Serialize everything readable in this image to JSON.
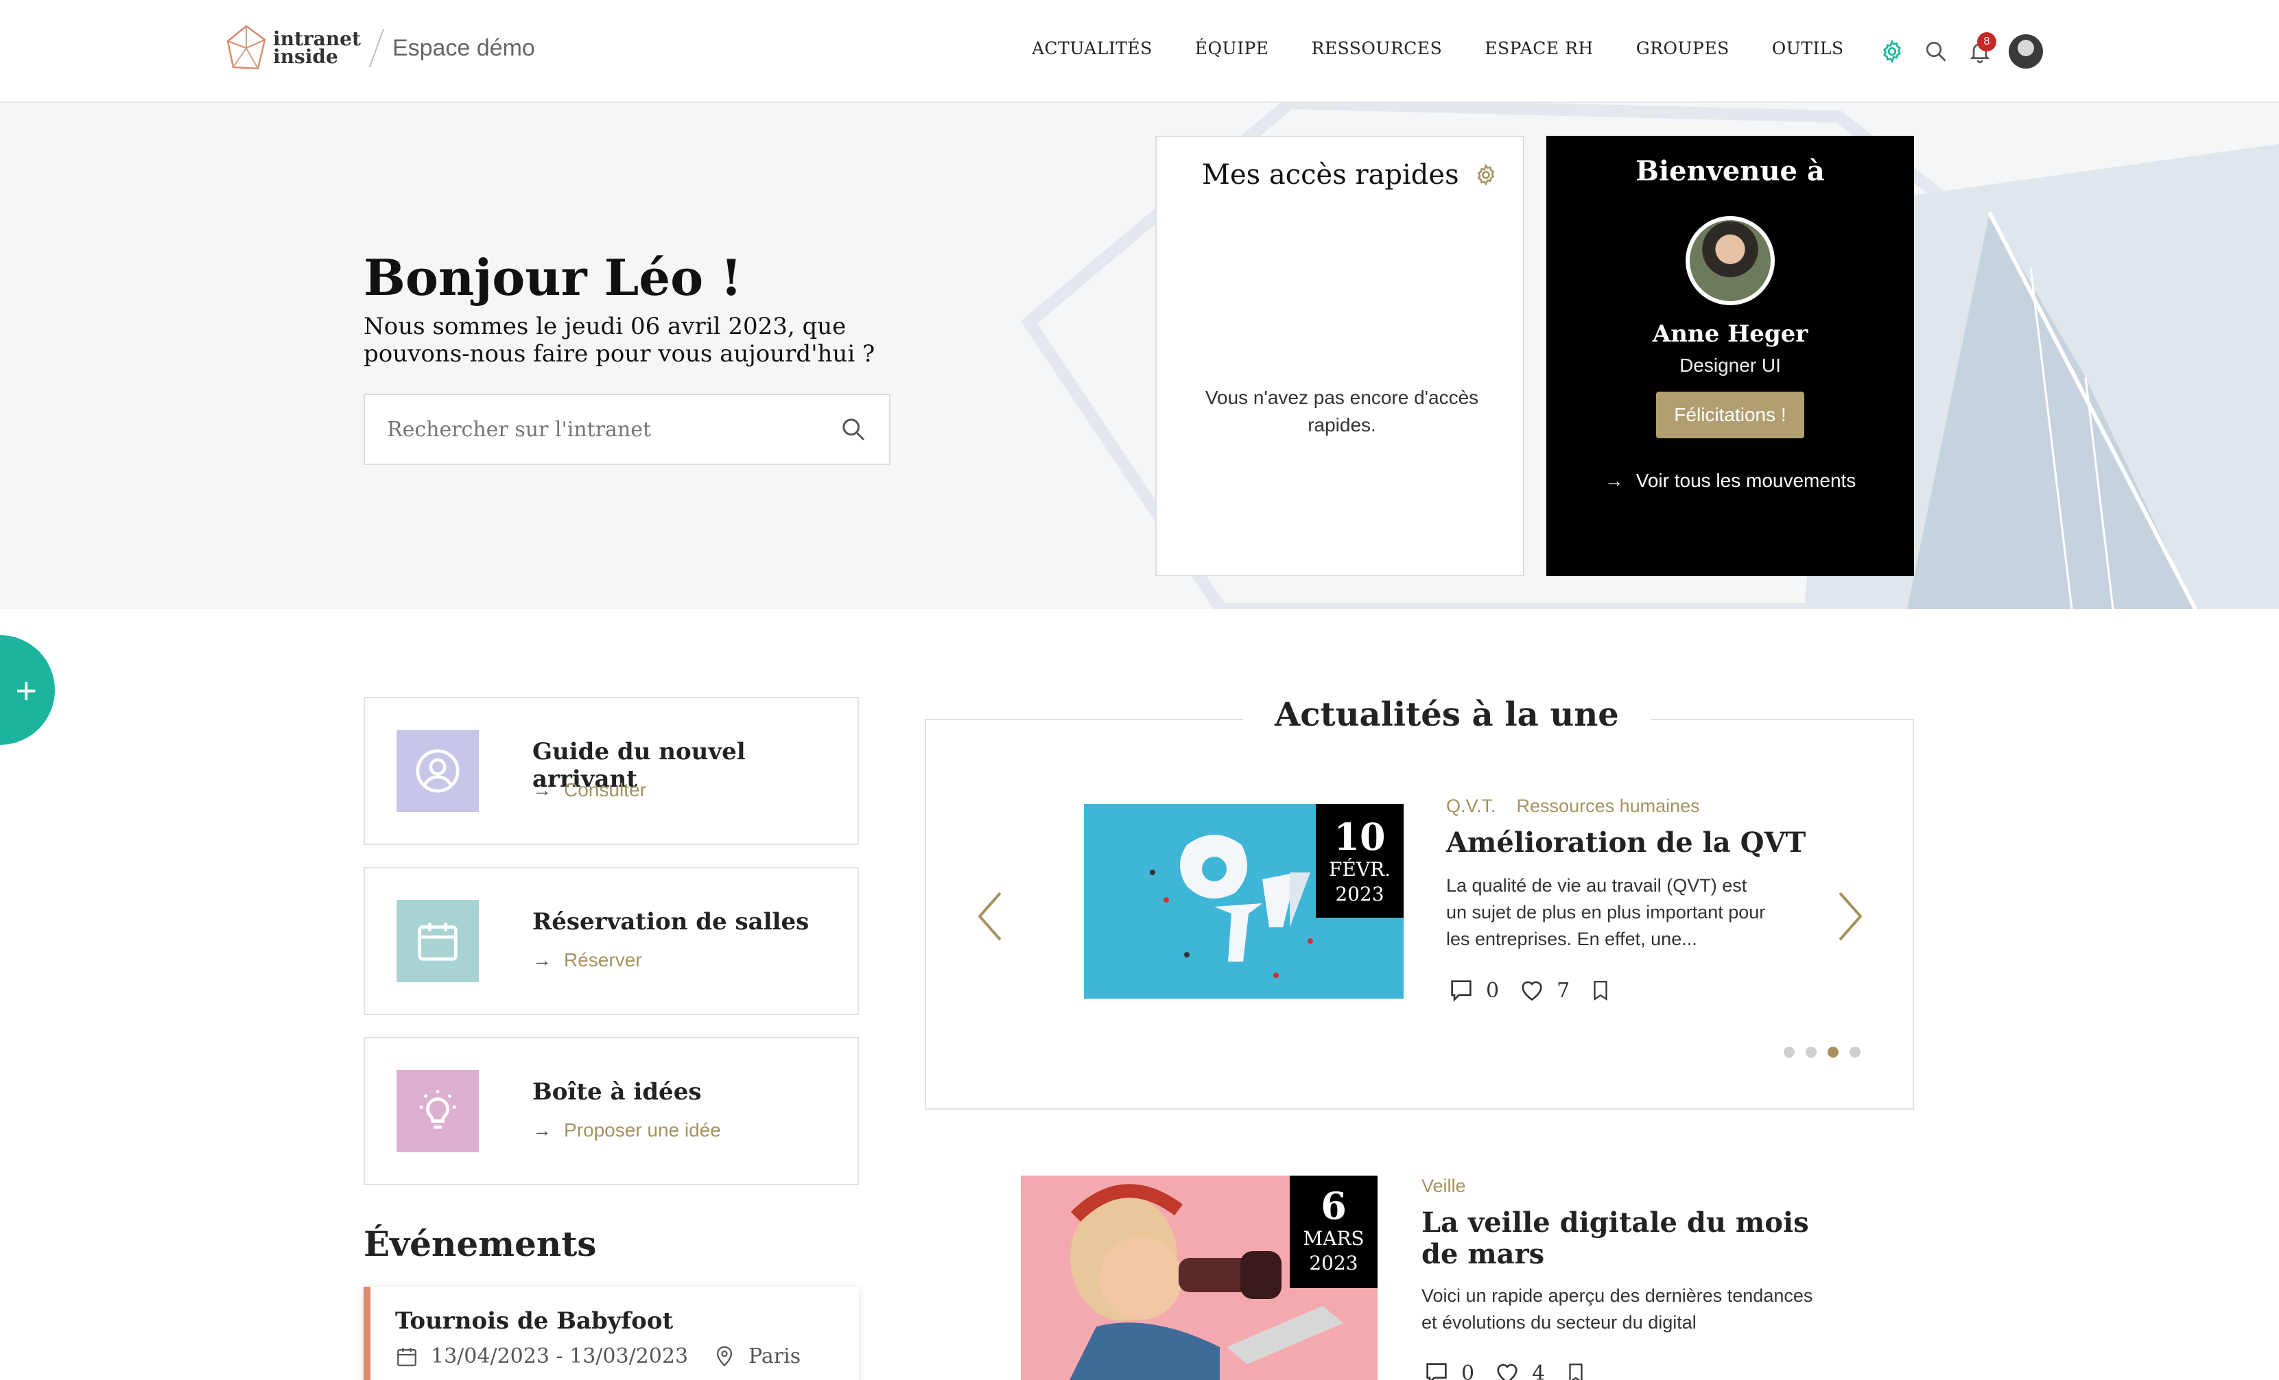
{
  "header": {
    "logo_line1": "intranet",
    "logo_line2": "inside",
    "space_name": "Espace démo",
    "nav": [
      "ACTUALITÉS",
      "ÉQUIPE",
      "RESSOURCES",
      "ESPACE RH",
      "GROUPES",
      "OUTILS"
    ],
    "notifications_count": "8",
    "accent_color": "#1cb49c"
  },
  "hero": {
    "greeting": "Bonjour Léo !",
    "subtitle": "Nous sommes le jeudi 06 avril 2023, que pouvons-nous faire pour vous aujourd'hui ?",
    "search_placeholder": "Rechercher sur l'intranet"
  },
  "quick_access": {
    "title": "Mes accès rapides",
    "empty_text": "Vous n'avez pas encore d'accès rapides."
  },
  "welcome": {
    "title": "Bienvenue à",
    "name": "Anne Heger",
    "role": "Designer UI",
    "button": "Félicitations !",
    "link": "Voir tous les mouvements"
  },
  "fab_label": "+",
  "cards": [
    {
      "title": "Guide du nouvel arrivant",
      "link": "Consulter",
      "icon": "user-circle-icon",
      "color": "#c8c6e8"
    },
    {
      "title": "Réservation de salles",
      "link": "Réserver",
      "icon": "calendar-icon",
      "color": "#a9d3d3"
    },
    {
      "title": "Boîte à idées",
      "link": "Proposer une idée",
      "icon": "lightbulb-icon",
      "color": "#dcaed0"
    }
  ],
  "events": {
    "title": "Événements",
    "items": [
      {
        "title": "Tournois de Babyfoot",
        "dates": "13/04/2023 - 13/03/2023",
        "location": "Paris"
      }
    ]
  },
  "news": {
    "heading": "Actualités à la une",
    "featured": {
      "day": "10",
      "month": "FÉVR.",
      "year": "2023",
      "tags": [
        "Q.V.T.",
        "Ressources humaines"
      ],
      "title": "Amélioration de la QVT",
      "description": "La qualité de vie au travail (QVT) est un sujet de plus en plus important pour les entreprises. En effet, une...",
      "comments": "0",
      "likes": "7"
    },
    "dots_total": 4,
    "dots_active": 3,
    "second": {
      "day": "6",
      "month": "MARS",
      "year": "2023",
      "tag": "Veille",
      "title": "La veille digitale du mois de mars",
      "description": "Voici un rapide aperçu des dernières tendances et évolutions du secteur du digital",
      "comments": "0",
      "likes": "4"
    }
  }
}
